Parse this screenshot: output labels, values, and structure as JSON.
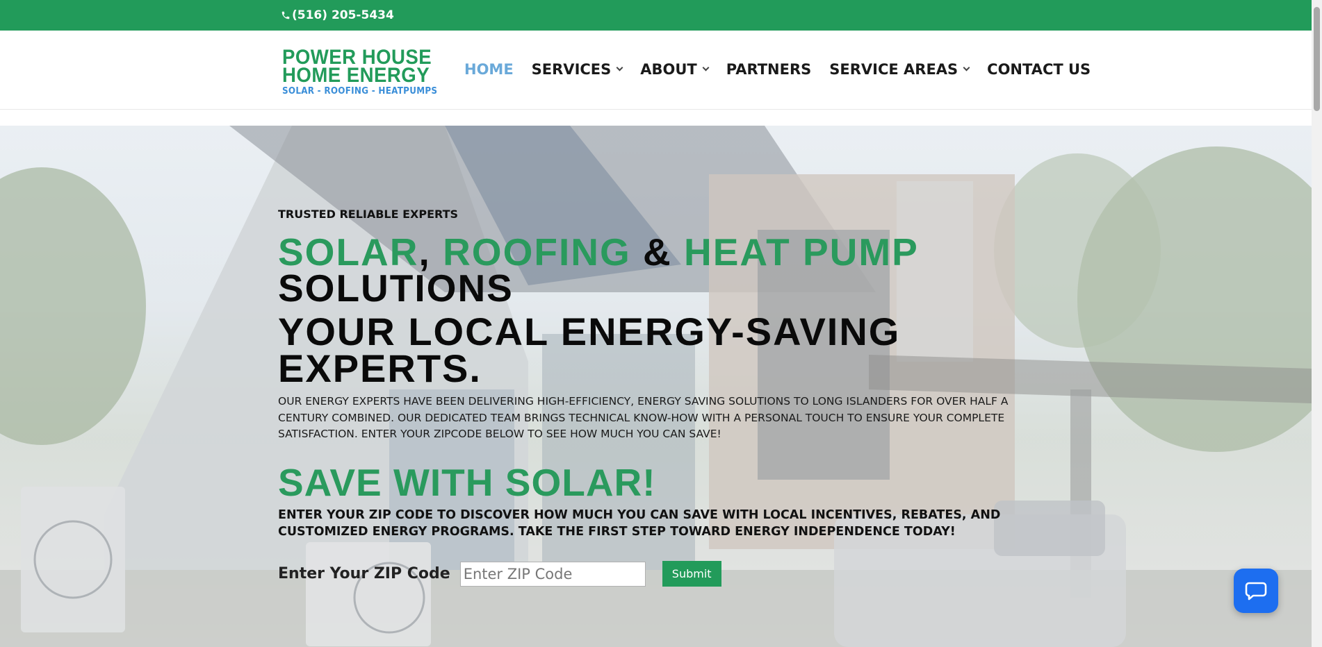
{
  "topbar": {
    "phone": "(516) 205-5434",
    "phone_icon": "phone-icon",
    "color": "#229b5a"
  },
  "logo": {
    "line1": "POWER HOUSE",
    "line2": "HOME ENERGY",
    "tagline": "SOLAR - ROOFING - HEATPUMPS"
  },
  "nav": {
    "items": [
      {
        "label": "HOME",
        "active": true
      },
      {
        "label": "SERVICES",
        "has_dropdown": true
      },
      {
        "label": "ABOUT",
        "has_dropdown": true
      },
      {
        "label": "PARTNERS"
      },
      {
        "label": "SERVICE AREAS",
        "has_dropdown": true
      },
      {
        "label": "CONTACT US"
      }
    ]
  },
  "hero": {
    "eyebrow": "TRUSTED RELIABLE EXPERTS",
    "headline": {
      "w1": "SOLAR",
      "sep1": ",",
      "w2": "ROOFING",
      "sep2": "&",
      "w3": "HEAT PUMP",
      "w4": "SOLUTIONS"
    },
    "subheadline_l1": "YOUR LOCAL ENERGY-SAVING",
    "subheadline_l2": "EXPERTS.",
    "description": "OUR ENERGY EXPERTS HAVE BEEN DELIVERING HIGH-EFFICIENCY, ENERGY SAVING SOLUTIONS TO LONG ISLANDERS FOR OVER HALF A CENTURY COMBINED. OUR DEDICATED TEAM BRINGS TECHNICAL KNOW-HOW WITH A PERSONAL TOUCH TO ENSURE YOUR COMPLETE SATISFACTION. ENTER YOUR ZIPCODE BELOW TO SEE HOW MUCH YOU CAN SAVE!",
    "save_heading": "SAVE WITH SOLAR!",
    "save_sub": "ENTER YOUR ZIP CODE TO DISCOVER HOW MUCH YOU CAN SAVE WITH LOCAL INCENTIVES, REBATES, AND CUSTOMIZED ENERGY PROGRAMS. TAKE THE FIRST STEP TOWARD ENERGY INDEPENDENCE TODAY!",
    "zip_label": "Enter Your ZIP Code",
    "zip_placeholder": "Enter ZIP Code",
    "zip_value": "",
    "submit_label": "Submit"
  },
  "chat": {
    "icon": "chat-bubble-icon",
    "color": "#1d6ef0"
  },
  "colors": {
    "brand_green": "#229b5a",
    "nav_active": "#6aa9d9",
    "logo_blue": "#3a8ed8"
  }
}
